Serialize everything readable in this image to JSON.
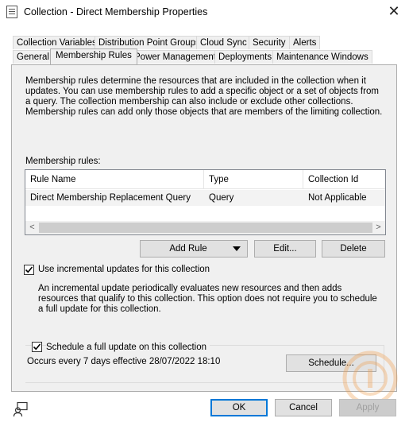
{
  "window": {
    "title": "Collection - Direct Membership Properties",
    "app_icon": "document-properties-icon",
    "close_icon": "close-icon"
  },
  "tabs_row1": [
    {
      "label": "Collection Variables"
    },
    {
      "label": "Distribution Point Groups"
    },
    {
      "label": "Cloud Sync"
    },
    {
      "label": "Security"
    },
    {
      "label": "Alerts"
    }
  ],
  "tabs_row2": [
    {
      "label": "General"
    },
    {
      "label": "Membership Rules",
      "active": true
    },
    {
      "label": "Power Management"
    },
    {
      "label": "Deployments"
    },
    {
      "label": "Maintenance Windows"
    }
  ],
  "description": "Membership rules determine the resources that are included in the collection when it updates. You can use membership rules to add a specific object or a set of objects from a query. The collection membership can also include or exclude other collections. Membership rules can add only those objects that are members of the limiting collection.",
  "rules": {
    "label": "Membership rules:",
    "columns": [
      "Rule Name",
      "Type",
      "Collection Id"
    ],
    "rows": [
      [
        "Direct Membership Replacement Query",
        "Query",
        "Not Applicable"
      ]
    ]
  },
  "buttons": {
    "add_rule": "Add Rule",
    "edit": "Edit...",
    "delete": "Delete",
    "schedule": "Schedule...",
    "ok": "OK",
    "cancel": "Cancel",
    "apply": "Apply"
  },
  "incremental": {
    "checked": true,
    "label": "Use incremental updates for this collection",
    "help": "An incremental update periodically evaluates new resources and then adds resources that qualify to this collection. This option does not require you to schedule a full update for this collection."
  },
  "full_update": {
    "checked": true,
    "label": "Schedule a full update on this collection",
    "schedule_text": "Occurs every 7 days effective 28/07/2022 18:10"
  },
  "status_icon": "user-feedback-icon",
  "colors": {
    "accent": "#0078d7",
    "panel": "#f0f0f0",
    "watermark": "#f0a050"
  }
}
